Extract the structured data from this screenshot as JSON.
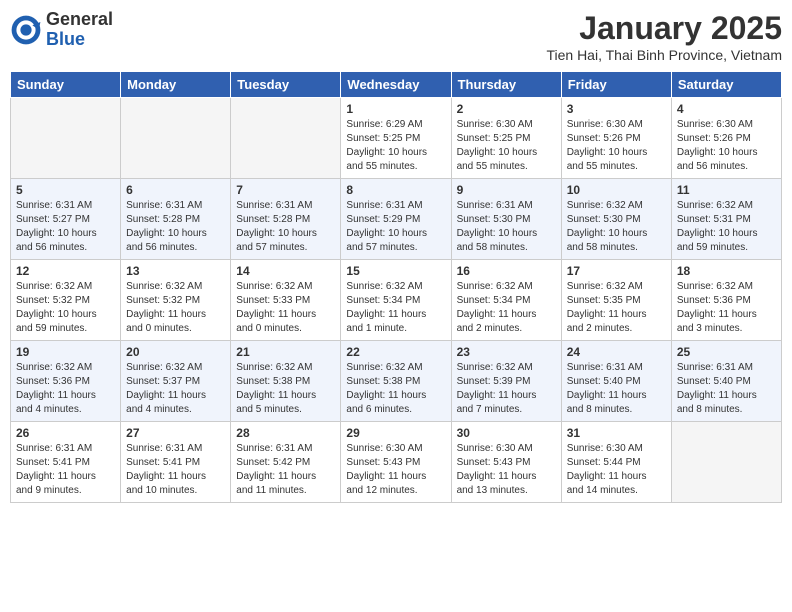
{
  "header": {
    "logo_general": "General",
    "logo_blue": "Blue",
    "month_title": "January 2025",
    "subtitle": "Tien Hai, Thai Binh Province, Vietnam"
  },
  "days_of_week": [
    "Sunday",
    "Monday",
    "Tuesday",
    "Wednesday",
    "Thursday",
    "Friday",
    "Saturday"
  ],
  "weeks": [
    [
      {
        "day": "",
        "info": ""
      },
      {
        "day": "",
        "info": ""
      },
      {
        "day": "",
        "info": ""
      },
      {
        "day": "1",
        "info": "Sunrise: 6:29 AM\nSunset: 5:25 PM\nDaylight: 10 hours and 55 minutes."
      },
      {
        "day": "2",
        "info": "Sunrise: 6:30 AM\nSunset: 5:25 PM\nDaylight: 10 hours and 55 minutes."
      },
      {
        "day": "3",
        "info": "Sunrise: 6:30 AM\nSunset: 5:26 PM\nDaylight: 10 hours and 55 minutes."
      },
      {
        "day": "4",
        "info": "Sunrise: 6:30 AM\nSunset: 5:26 PM\nDaylight: 10 hours and 56 minutes."
      }
    ],
    [
      {
        "day": "5",
        "info": "Sunrise: 6:31 AM\nSunset: 5:27 PM\nDaylight: 10 hours and 56 minutes."
      },
      {
        "day": "6",
        "info": "Sunrise: 6:31 AM\nSunset: 5:28 PM\nDaylight: 10 hours and 56 minutes."
      },
      {
        "day": "7",
        "info": "Sunrise: 6:31 AM\nSunset: 5:28 PM\nDaylight: 10 hours and 57 minutes."
      },
      {
        "day": "8",
        "info": "Sunrise: 6:31 AM\nSunset: 5:29 PM\nDaylight: 10 hours and 57 minutes."
      },
      {
        "day": "9",
        "info": "Sunrise: 6:31 AM\nSunset: 5:30 PM\nDaylight: 10 hours and 58 minutes."
      },
      {
        "day": "10",
        "info": "Sunrise: 6:32 AM\nSunset: 5:30 PM\nDaylight: 10 hours and 58 minutes."
      },
      {
        "day": "11",
        "info": "Sunrise: 6:32 AM\nSunset: 5:31 PM\nDaylight: 10 hours and 59 minutes."
      }
    ],
    [
      {
        "day": "12",
        "info": "Sunrise: 6:32 AM\nSunset: 5:32 PM\nDaylight: 10 hours and 59 minutes."
      },
      {
        "day": "13",
        "info": "Sunrise: 6:32 AM\nSunset: 5:32 PM\nDaylight: 11 hours and 0 minutes."
      },
      {
        "day": "14",
        "info": "Sunrise: 6:32 AM\nSunset: 5:33 PM\nDaylight: 11 hours and 0 minutes."
      },
      {
        "day": "15",
        "info": "Sunrise: 6:32 AM\nSunset: 5:34 PM\nDaylight: 11 hours and 1 minute."
      },
      {
        "day": "16",
        "info": "Sunrise: 6:32 AM\nSunset: 5:34 PM\nDaylight: 11 hours and 2 minutes."
      },
      {
        "day": "17",
        "info": "Sunrise: 6:32 AM\nSunset: 5:35 PM\nDaylight: 11 hours and 2 minutes."
      },
      {
        "day": "18",
        "info": "Sunrise: 6:32 AM\nSunset: 5:36 PM\nDaylight: 11 hours and 3 minutes."
      }
    ],
    [
      {
        "day": "19",
        "info": "Sunrise: 6:32 AM\nSunset: 5:36 PM\nDaylight: 11 hours and 4 minutes."
      },
      {
        "day": "20",
        "info": "Sunrise: 6:32 AM\nSunset: 5:37 PM\nDaylight: 11 hours and 4 minutes."
      },
      {
        "day": "21",
        "info": "Sunrise: 6:32 AM\nSunset: 5:38 PM\nDaylight: 11 hours and 5 minutes."
      },
      {
        "day": "22",
        "info": "Sunrise: 6:32 AM\nSunset: 5:38 PM\nDaylight: 11 hours and 6 minutes."
      },
      {
        "day": "23",
        "info": "Sunrise: 6:32 AM\nSunset: 5:39 PM\nDaylight: 11 hours and 7 minutes."
      },
      {
        "day": "24",
        "info": "Sunrise: 6:31 AM\nSunset: 5:40 PM\nDaylight: 11 hours and 8 minutes."
      },
      {
        "day": "25",
        "info": "Sunrise: 6:31 AM\nSunset: 5:40 PM\nDaylight: 11 hours and 8 minutes."
      }
    ],
    [
      {
        "day": "26",
        "info": "Sunrise: 6:31 AM\nSunset: 5:41 PM\nDaylight: 11 hours and 9 minutes."
      },
      {
        "day": "27",
        "info": "Sunrise: 6:31 AM\nSunset: 5:41 PM\nDaylight: 11 hours and 10 minutes."
      },
      {
        "day": "28",
        "info": "Sunrise: 6:31 AM\nSunset: 5:42 PM\nDaylight: 11 hours and 11 minutes."
      },
      {
        "day": "29",
        "info": "Sunrise: 6:30 AM\nSunset: 5:43 PM\nDaylight: 11 hours and 12 minutes."
      },
      {
        "day": "30",
        "info": "Sunrise: 6:30 AM\nSunset: 5:43 PM\nDaylight: 11 hours and 13 minutes."
      },
      {
        "day": "31",
        "info": "Sunrise: 6:30 AM\nSunset: 5:44 PM\nDaylight: 11 hours and 14 minutes."
      },
      {
        "day": "",
        "info": ""
      }
    ]
  ]
}
